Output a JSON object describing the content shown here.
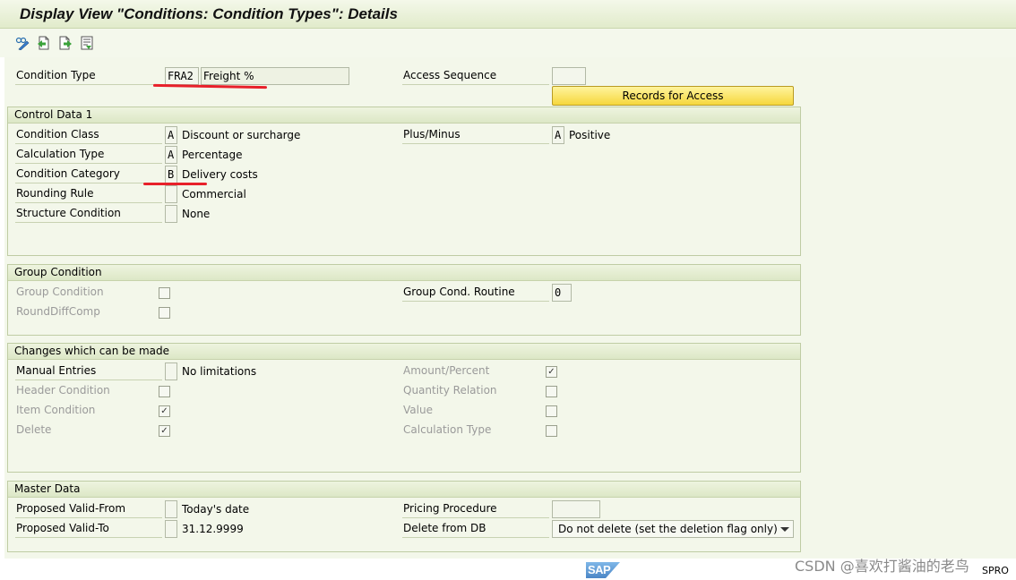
{
  "window": {
    "title": "Display View \"Conditions: Condition Types\": Details"
  },
  "toolbar": {
    "icons": [
      "display-change-icon",
      "previous-entry-icon",
      "next-entry-icon",
      "variable-list-icon"
    ]
  },
  "header": {
    "condition_type_label": "Condition Type",
    "condition_type_code": "FRA2",
    "condition_type_desc": "Freight %",
    "access_sequence_label": "Access Sequence",
    "access_sequence_value": "",
    "records_button": "Records for Access"
  },
  "control_data": {
    "title": "Control Data 1",
    "condition_class": {
      "label": "Condition Class",
      "code": "A",
      "text": "Discount or surcharge"
    },
    "calculation_type": {
      "label": "Calculation Type",
      "code": "A",
      "text": "Percentage"
    },
    "condition_category": {
      "label": "Condition Category",
      "code": "B",
      "text": "Delivery costs"
    },
    "rounding_rule": {
      "label": "Rounding Rule",
      "code": "",
      "text": "Commercial"
    },
    "structure_condition": {
      "label": "Structure Condition",
      "code": "",
      "text": "None"
    },
    "plus_minus": {
      "label": "Plus/Minus",
      "code": "A",
      "text": "Positive"
    }
  },
  "group_condition": {
    "title": "Group Condition",
    "group_condition": {
      "label": "Group Condition",
      "checked": false
    },
    "round_diff_comp": {
      "label": "RoundDiffComp",
      "checked": false
    },
    "group_cond_routine": {
      "label": "Group Cond. Routine",
      "value": "0"
    }
  },
  "changes": {
    "title": "Changes which can be made",
    "manual_entries": {
      "label": "Manual Entries",
      "code": "",
      "text": "No limitations"
    },
    "header_condition": {
      "label": "Header Condition",
      "checked": false
    },
    "item_condition": {
      "label": "Item Condition",
      "checked": true
    },
    "delete": {
      "label": "Delete",
      "checked": true
    },
    "amount_percent": {
      "label": "Amount/Percent",
      "checked": true
    },
    "quantity_relation": {
      "label": "Quantity Relation",
      "checked": false
    },
    "value": {
      "label": "Value",
      "checked": false
    },
    "calculation_type": {
      "label": "Calculation Type",
      "checked": false
    }
  },
  "master_data": {
    "title": "Master Data",
    "proposed_valid_from": {
      "label": "Proposed Valid-From",
      "code": "",
      "text": "Today's date"
    },
    "proposed_valid_to": {
      "label": "Proposed Valid-To",
      "code": "",
      "text": "31.12.9999"
    },
    "pricing_procedure": {
      "label": "Pricing Procedure",
      "value": ""
    },
    "delete_from_db": {
      "label": "Delete from DB",
      "value": "Do not delete (set the deletion flag only)"
    }
  },
  "footer": {
    "sap_logo_text": "SAP",
    "watermark": "CSDN @喜欢打酱油的老鸟",
    "transaction": "SPRO"
  },
  "colors": {
    "title_bg": "#e1ebcb",
    "button_yellow": "#f6d73d",
    "annotation_red": "#e8202a",
    "panel_bg": "#f3f7ea"
  }
}
